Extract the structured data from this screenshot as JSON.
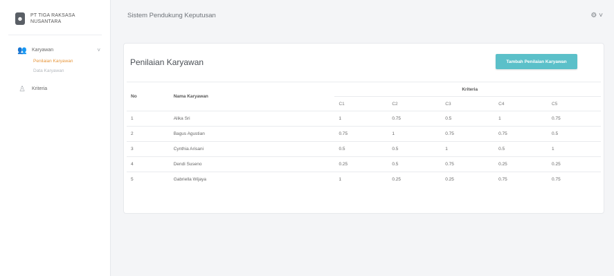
{
  "brand": {
    "line1": "PT TIGA RAKSASA",
    "line2": "NUSANTARA"
  },
  "sidebar": {
    "menu1_label": "Karyawan",
    "submenu": [
      "Penilaian Karyawan",
      "Data Karyawan"
    ],
    "menu2_label": "Kriteria"
  },
  "topbar": {
    "title": "Sistem Pendukung Keputusan"
  },
  "card": {
    "title": "Penilaian Karyawan",
    "button_label": "Tambah Penilaian Karyawan"
  },
  "table": {
    "headers": {
      "no": "No",
      "name": "Nama Karyawan",
      "group": "Kriteria"
    },
    "criteria": [
      "C1",
      "C2",
      "C3",
      "C4",
      "C5"
    ],
    "rows": [
      {
        "no": "1",
        "name": "Alika Sri",
        "c": [
          "1",
          "0.75",
          "0.5",
          "1",
          "0.75"
        ]
      },
      {
        "no": "2",
        "name": "Bagus Agustian",
        "c": [
          "0.75",
          "1",
          "0.75",
          "0.75",
          "0.5"
        ]
      },
      {
        "no": "3",
        "name": "Cynthia Arisani",
        "c": [
          "0.5",
          "0.5",
          "1",
          "0.5",
          "1"
        ]
      },
      {
        "no": "4",
        "name": "Dendi Suseno",
        "c": [
          "0.25",
          "0.5",
          "0.75",
          "0.25",
          "0.25"
        ]
      },
      {
        "no": "5",
        "name": "Gabriella Wijaya",
        "c": [
          "1",
          "0.25",
          "0.25",
          "0.75",
          "0.75"
        ]
      }
    ]
  }
}
